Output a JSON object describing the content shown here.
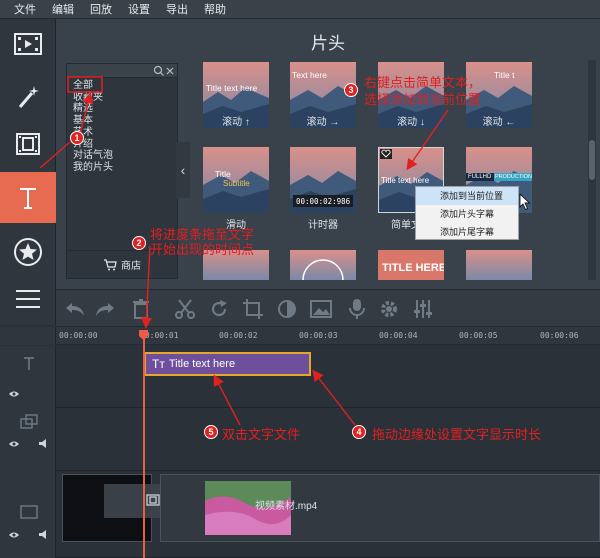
{
  "menu": [
    "文件",
    "编辑",
    "回放",
    "设置",
    "导出",
    "帮助"
  ],
  "panel": {
    "title": "片头",
    "categories": [
      "全部",
      "收藏夹",
      "精选",
      "基本",
      "艺术",
      "介绍",
      "对话气泡",
      "我的片头"
    ],
    "shop_label": "商店"
  },
  "thumbs": [
    {
      "caption": "Title text here",
      "label": "滚动 ↑"
    },
    {
      "caption": "Text here",
      "label": "滚动 →"
    },
    {
      "caption": "",
      "label": "滚动 ↓"
    },
    {
      "caption": "Title t",
      "label": "滚动 ←"
    },
    {
      "caption": "Title",
      "caption2": "Subtitle",
      "label": "滑动"
    },
    {
      "caption": "00:00:02:986",
      "label": "计时器"
    },
    {
      "caption": "Title text here",
      "label": "简单文"
    },
    {
      "caption": "FULLHD",
      "caption2": "PRODUCTION",
      "label": ""
    },
    {
      "caption": "",
      "label": ""
    },
    {
      "caption": "",
      "label": ""
    },
    {
      "caption": "TITLE HERE",
      "label": ""
    },
    {
      "caption": "",
      "label": ""
    }
  ],
  "context_menu": [
    "添加到当前位置",
    "添加片头字幕",
    "添加片尾字幕"
  ],
  "ruler": [
    "00:00:00",
    "00:00:01",
    "00:00:02",
    "00:00:03",
    "00:00:04",
    "00:00:05",
    "00:00:06"
  ],
  "clips": {
    "title_clip": "Title text here",
    "video_clip": "视频素材.mp4"
  },
  "annotations": {
    "a1": "1",
    "a2_num": "2",
    "a2_line1": "将进度条拖至文字",
    "a2_line2": "开始出现的时间点",
    "a3_num": "3",
    "a3_line1": "右键点击简单文本，",
    "a3_line2": "选择添加到当前位置",
    "a4_num": "4",
    "a4_text": "拖动边缘处设置文字显示时长",
    "a5_num": "5",
    "a5_text": "双击文字文件"
  },
  "colors": {
    "accent": "#e76b50",
    "annotation": "#e12020",
    "clip_purple": "#6d4f9b",
    "clip_border": "#e4a72a"
  }
}
